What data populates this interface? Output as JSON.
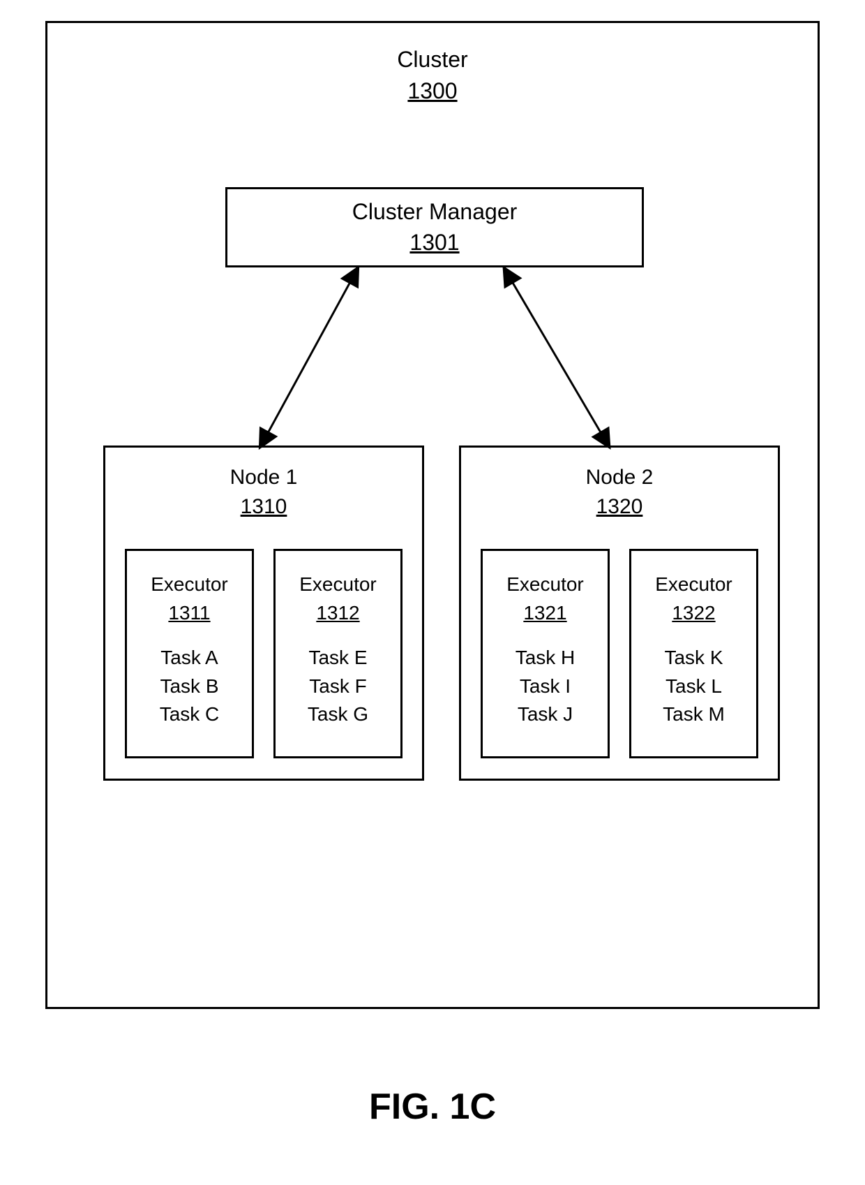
{
  "figure_caption": "FIG. 1C",
  "cluster": {
    "label": "Cluster",
    "ref": "1300",
    "manager": {
      "label": "Cluster Manager",
      "ref": "1301"
    },
    "nodes": [
      {
        "label": "Node 1",
        "ref": "1310",
        "executors": [
          {
            "label": "Executor",
            "ref": "1311",
            "tasks": [
              "Task A",
              "Task B",
              "Task C"
            ]
          },
          {
            "label": "Executor",
            "ref": "1312",
            "tasks": [
              "Task E",
              "Task F",
              "Task G"
            ]
          }
        ]
      },
      {
        "label": "Node 2",
        "ref": "1320",
        "executors": [
          {
            "label": "Executor",
            "ref": "1321",
            "tasks": [
              "Task H",
              "Task I",
              "Task J"
            ]
          },
          {
            "label": "Executor",
            "ref": "1322",
            "tasks": [
              "Task K",
              "Task L",
              "Task M"
            ]
          }
        ]
      }
    ]
  }
}
